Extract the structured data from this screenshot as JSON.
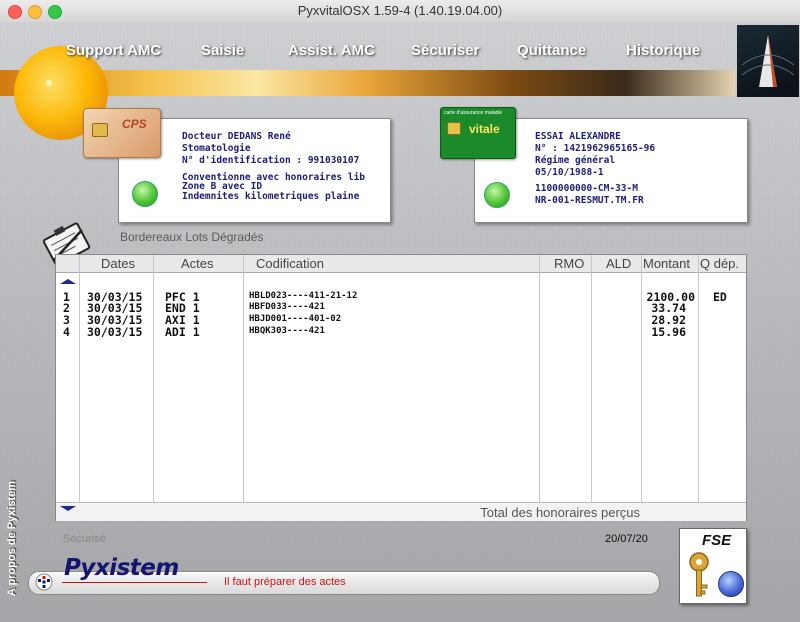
{
  "window": {
    "title": "PyxvitalOSX  1.59-4 (1.40.19.04.00)"
  },
  "menu": [
    {
      "label": "Support AMC"
    },
    {
      "label": "Saisie"
    },
    {
      "label": "Assist. AMC"
    },
    {
      "label": "Sécuriser"
    },
    {
      "label": "Quittance"
    },
    {
      "label": "Historique"
    }
  ],
  "practitioner": {
    "card_label": "CPS",
    "name": "Docteur DEDANS René",
    "specialty": "Stomatologie",
    "id_line": "N° d'identification :  991030107",
    "convention": "Conventionne avec honoraires lib",
    "zone": "Zone B avec ID",
    "indemnites": "Indemnites kilometriques plaine"
  },
  "patient": {
    "card_label": "vitale",
    "card_top": "carte d'assurance maladie",
    "name": "ESSAI ALEXANDRE",
    "nir": "N° : 1421962965165-96",
    "regime": "Régime général",
    "birthdate": "05/10/1988-1",
    "code": "1100000000-CM-33-M",
    "mutuelle": "NR-001-RESMUT.TM.FR"
  },
  "bordereaux": {
    "label": "Bordereaux Lots Dégradés"
  },
  "table": {
    "headers": [
      "Dates",
      "Actes",
      "Codification",
      "RMO",
      "ALD",
      "Montant",
      "Q dép."
    ],
    "rows": [
      {
        "num": "1",
        "date": "30/03/15",
        "acte": "PFC 1",
        "codif": "HBLD023----411-21-12",
        "montant": "2100.00",
        "qdep": "ED"
      },
      {
        "num": "2",
        "date": "30/03/15",
        "acte": "END 1",
        "codif": "HBFD033----421",
        "montant": "33.74",
        "qdep": ""
      },
      {
        "num": "3",
        "date": "30/03/15",
        "acte": "AXI 1",
        "codif": "HBJD001----401-02",
        "montant": "28.92",
        "qdep": ""
      },
      {
        "num": "4",
        "date": "30/03/15",
        "acte": "ADI 1",
        "codif": "HBQK303----421",
        "montant": "15.96",
        "qdep": ""
      }
    ],
    "total_label": "Total des honoraires perçus"
  },
  "status": {
    "secured": "Sécurisé",
    "date": "20/07/20",
    "brand": "Pyxistem",
    "message": "Il faut préparer des actes",
    "fse_label": "FSE",
    "side_link": "A propos de Pyxistem"
  }
}
